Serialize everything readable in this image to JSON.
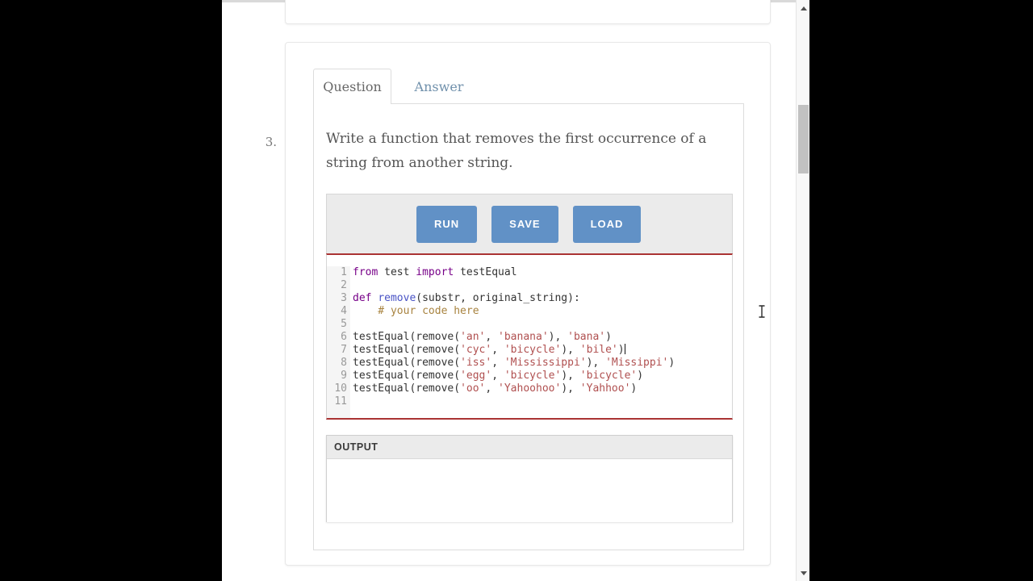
{
  "page": {
    "question_number": "3.",
    "tabs": [
      {
        "label": "Question",
        "active": true
      },
      {
        "label": "Answer",
        "active": false
      }
    ],
    "question_text": "Write a function that removes the first occurrence of a string from another string.",
    "toolbar": {
      "buttons": [
        {
          "label": "RUN"
        },
        {
          "label": "SAVE"
        },
        {
          "label": "LOAD"
        }
      ]
    },
    "output": {
      "header": "OUTPUT",
      "content": ""
    }
  },
  "editor": {
    "caret_after_line": 7,
    "lines": [
      [
        {
          "t": "from",
          "c": "kw"
        },
        {
          "t": " test ",
          "c": "pl"
        },
        {
          "t": "import",
          "c": "kw"
        },
        {
          "t": " testEqual",
          "c": "pl"
        }
      ],
      [],
      [
        {
          "t": "def",
          "c": "kw"
        },
        {
          "t": " ",
          "c": "pl"
        },
        {
          "t": "remove",
          "c": "def"
        },
        {
          "t": "(substr, original_string):",
          "c": "pl"
        }
      ],
      [
        {
          "t": "    # your code here",
          "c": "cm"
        }
      ],
      [],
      [
        {
          "t": "testEqual(remove(",
          "c": "pl"
        },
        {
          "t": "'an'",
          "c": "str"
        },
        {
          "t": ", ",
          "c": "pl"
        },
        {
          "t": "'banana'",
          "c": "str"
        },
        {
          "t": "), ",
          "c": "pl"
        },
        {
          "t": "'bana'",
          "c": "str"
        },
        {
          "t": ")",
          "c": "pl"
        }
      ],
      [
        {
          "t": "testEqual(remove(",
          "c": "pl"
        },
        {
          "t": "'cyc'",
          "c": "str"
        },
        {
          "t": ", ",
          "c": "pl"
        },
        {
          "t": "'bicycle'",
          "c": "str"
        },
        {
          "t": "), ",
          "c": "pl"
        },
        {
          "t": "'bile'",
          "c": "str"
        },
        {
          "t": ")",
          "c": "pl"
        }
      ],
      [
        {
          "t": "testEqual(remove(",
          "c": "pl"
        },
        {
          "t": "'iss'",
          "c": "str"
        },
        {
          "t": ", ",
          "c": "pl"
        },
        {
          "t": "'Mississippi'",
          "c": "str"
        },
        {
          "t": "), ",
          "c": "pl"
        },
        {
          "t": "'Missippi'",
          "c": "str"
        },
        {
          "t": ")",
          "c": "pl"
        }
      ],
      [
        {
          "t": "testEqual(remove(",
          "c": "pl"
        },
        {
          "t": "'egg'",
          "c": "str"
        },
        {
          "t": ", ",
          "c": "pl"
        },
        {
          "t": "'bicycle'",
          "c": "str"
        },
        {
          "t": "), ",
          "c": "pl"
        },
        {
          "t": "'bicycle'",
          "c": "str"
        },
        {
          "t": ")",
          "c": "pl"
        }
      ],
      [
        {
          "t": "testEqual(remove(",
          "c": "pl"
        },
        {
          "t": "'oo'",
          "c": "str"
        },
        {
          "t": ", ",
          "c": "pl"
        },
        {
          "t": "'Yahoohoo'",
          "c": "str"
        },
        {
          "t": "), ",
          "c": "pl"
        },
        {
          "t": "'Yahhoo'",
          "c": "str"
        },
        {
          "t": ")",
          "c": "pl"
        }
      ],
      []
    ]
  },
  "colors": {
    "button_blue": "#6191c6",
    "editor_border_red": "#aa3333",
    "tab_link_blue": "#7191ac",
    "toolbar_gray": "#ebebeb",
    "keyword_purple": "#770088",
    "string_red": "#b05050",
    "comment_tan": "#a8833f",
    "def_blue": "#4953c5"
  }
}
